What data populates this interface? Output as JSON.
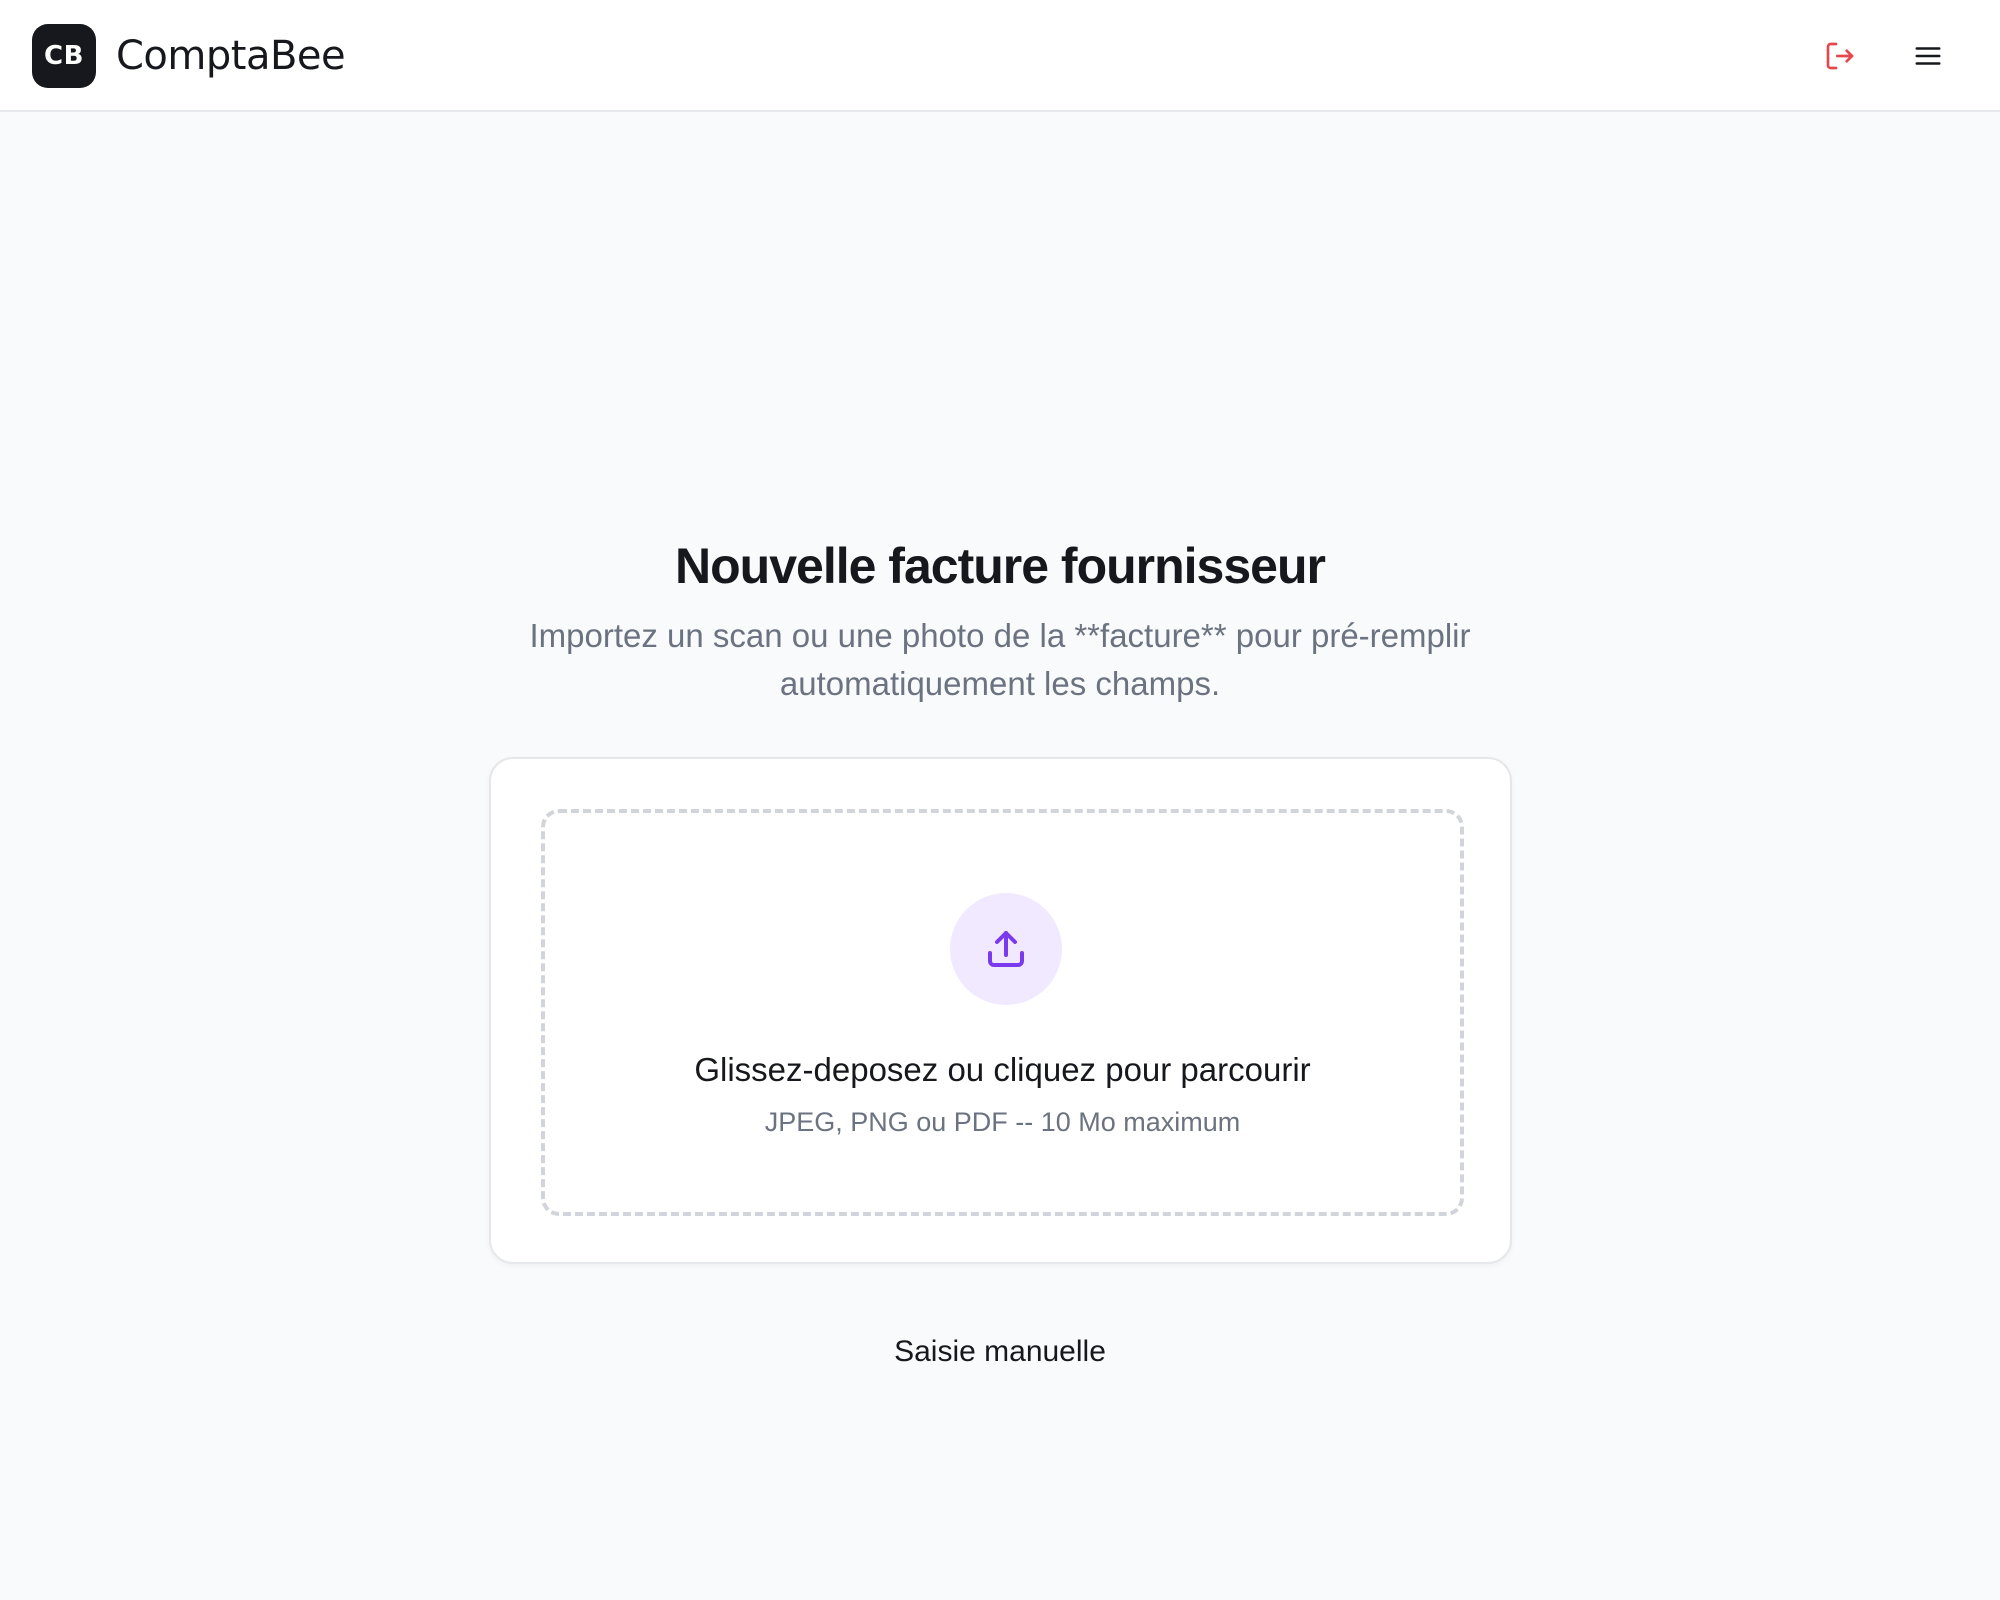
{
  "header": {
    "logo_text": "CB",
    "app_name": "ComptaBee",
    "logout_icon": "logout-icon",
    "menu_icon": "hamburger-menu-icon"
  },
  "main": {
    "title": "Nouvelle facture fournisseur",
    "subtitle": "Importez un scan ou une photo de la **facture** pour pré-remplir automatiquement les champs.",
    "dropzone": {
      "icon": "upload-icon",
      "label": "Glissez-deposez ou cliquez pour parcourir",
      "hint": "JPEG, PNG ou PDF -- 10 Mo maximum"
    },
    "manual_entry_label": "Saisie manuelle"
  },
  "colors": {
    "accent": "#7c3aed",
    "accent_bg": "#f1e9ff",
    "logout": "#e5484d",
    "background": "#f9fafb"
  }
}
